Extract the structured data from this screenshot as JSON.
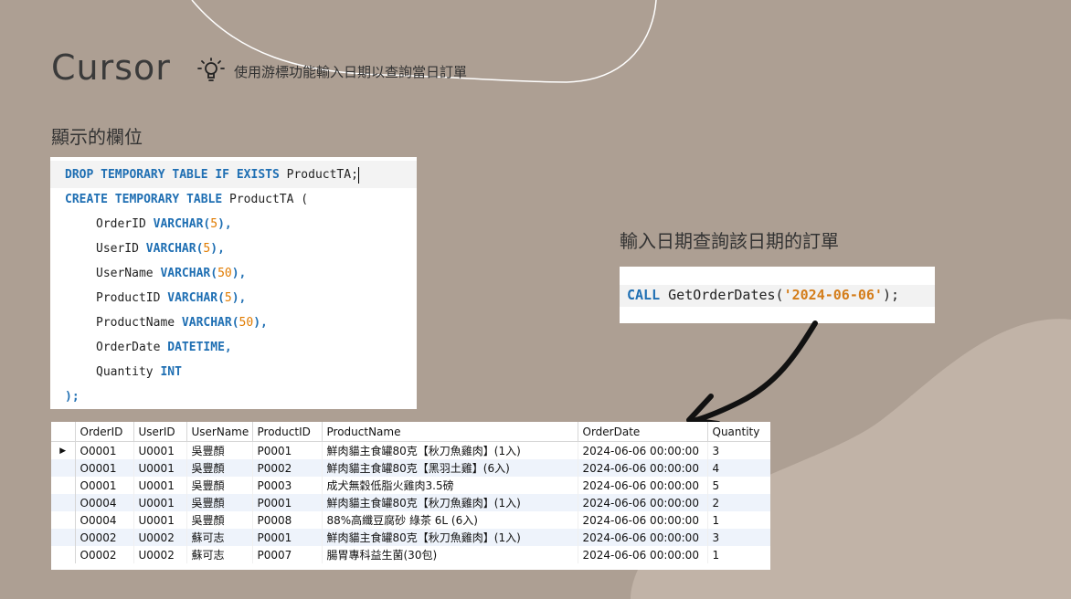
{
  "header": {
    "title": "Cursor",
    "subtitle": "使用游標功能輸入日期以查詢當日訂單",
    "icon": "lightbulb-icon"
  },
  "left_section": {
    "label": "顯示的欄位",
    "code": [
      [
        "DROP TEMPORARY TABLE IF EXISTS ",
        "ProductTA;"
      ],
      [
        "CREATE TEMPORARY TABLE ",
        "ProductTA ("
      ],
      [
        "OrderID ",
        "VARCHAR(",
        "5",
        "),"
      ],
      [
        "UserID ",
        "VARCHAR(",
        "5",
        "),"
      ],
      [
        "UserName ",
        "VARCHAR(",
        "50",
        "),"
      ],
      [
        "ProductID ",
        "VARCHAR(",
        "5",
        "),"
      ],
      [
        "ProductName ",
        "VARCHAR(",
        "50",
        "),"
      ],
      [
        "OrderDate ",
        "DATETIME",
        ","
      ],
      [
        "Quantity ",
        "INT"
      ],
      [
        ");"
      ]
    ]
  },
  "right_section": {
    "label": "輸入日期查詢該日期的訂單",
    "call_keyword": "CALL",
    "call_proc": " GetOrderDates(",
    "call_arg": "'2024-06-06'",
    "call_end": ");"
  },
  "result_grid": {
    "columns": [
      "OrderID",
      "UserID",
      "UserName",
      "ProductID",
      "ProductName",
      "OrderDate",
      "Quantity"
    ],
    "rows": [
      [
        "O0001",
        "U0001",
        "吳豐顏",
        "P0001",
        "鮮肉貓主食罐80克【秋刀魚雞肉】(1入)",
        "2024-06-06 00:00:00",
        "3"
      ],
      [
        "O0001",
        "U0001",
        "吳豐顏",
        "P0002",
        "鮮肉貓主食罐80克【黑羽土雞】(6入)",
        "2024-06-06 00:00:00",
        "4"
      ],
      [
        "O0001",
        "U0001",
        "吳豐顏",
        "P0003",
        "成犬無穀低脂火雞肉3.5磅",
        "2024-06-06 00:00:00",
        "5"
      ],
      [
        "O0004",
        "U0001",
        "吳豐顏",
        "P0001",
        "鮮肉貓主食罐80克【秋刀魚雞肉】(1入)",
        "2024-06-06 00:00:00",
        "2"
      ],
      [
        "O0004",
        "U0001",
        "吳豐顏",
        "P0008",
        "88%高纖豆腐砂 綠茶 6L (6入)",
        "2024-06-06 00:00:00",
        "1"
      ],
      [
        "O0002",
        "U0002",
        "蘇可志",
        "P0001",
        "鮮肉貓主食罐80克【秋刀魚雞肉】(1入)",
        "2024-06-06 00:00:00",
        "3"
      ],
      [
        "O0002",
        "U0002",
        "蘇可志",
        "P0007",
        "腸胃專科益生菌(30包)",
        "2024-06-06 00:00:00",
        "1"
      ]
    ],
    "current_row_marker": "▶"
  }
}
